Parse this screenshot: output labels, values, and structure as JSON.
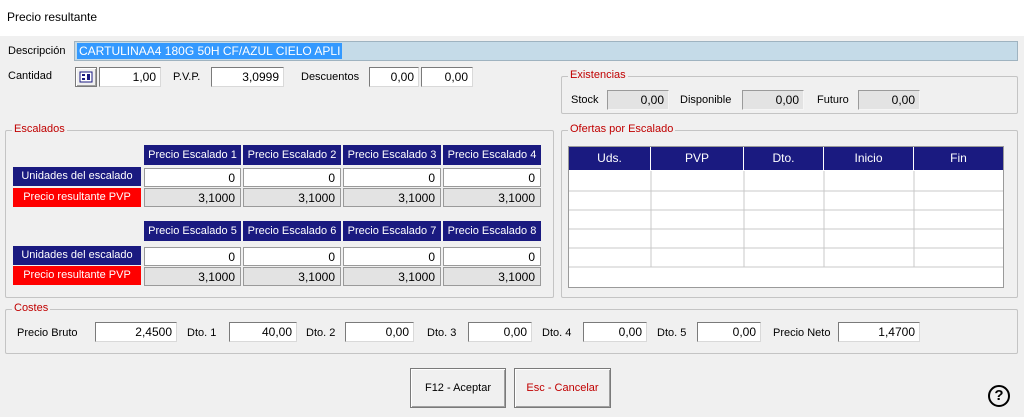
{
  "window": {
    "title": "Precio resultante"
  },
  "header": {
    "descripcion_label": "Descripción",
    "descripcion_value": "CARTULINAA4 180G 50H CF/AZUL CIELO APLI",
    "cantidad_label": "Cantidad",
    "cantidad_value": "1,00",
    "pvp_label": "P.V.P.",
    "pvp_value": "3,0999",
    "descuentos_label": "Descuentos",
    "descuento1_value": "0,00",
    "descuento2_value": "0,00"
  },
  "existencias": {
    "legend": "Existencias",
    "stock_label": "Stock",
    "stock_value": "0,00",
    "disponible_label": "Disponible",
    "disponible_value": "0,00",
    "futuro_label": "Futuro",
    "futuro_value": "0,00"
  },
  "escalados": {
    "legend": "Escalados",
    "row_unidades": "Unidades del escalado",
    "row_precio": "Precio resultante PVP",
    "block1": {
      "headers": [
        "Precio Escalado 1",
        "Precio Escalado 2",
        "Precio Escalado 3",
        "Precio Escalado 4"
      ],
      "unidades": [
        "0",
        "0",
        "0",
        "0"
      ],
      "precios": [
        "3,1000",
        "3,1000",
        "3,1000",
        "3,1000"
      ]
    },
    "block2": {
      "headers": [
        "Precio Escalado 5",
        "Precio Escalado 6",
        "Precio Escalado 7",
        "Precio Escalado 8"
      ],
      "unidades": [
        "0",
        "0",
        "0",
        "0"
      ],
      "precios": [
        "3,1000",
        "3,1000",
        "3,1000",
        "3,1000"
      ]
    }
  },
  "ofertas": {
    "legend": "Ofertas por Escalado",
    "columns": [
      "Uds.",
      "PVP",
      "Dto.",
      "Inicio",
      "Fin"
    ]
  },
  "costes": {
    "legend": "Costes",
    "precio_bruto_label": "Precio Bruto",
    "precio_bruto_value": "2,4500",
    "dto1_label": "Dto. 1",
    "dto1_value": "40,00",
    "dto2_label": "Dto. 2",
    "dto2_value": "0,00",
    "dto3_label": "Dto. 3",
    "dto3_value": "0,00",
    "dto4_label": "Dto. 4",
    "dto4_value": "0,00",
    "dto5_label": "Dto. 5",
    "dto5_value": "0,00",
    "precio_neto_label": "Precio Neto",
    "precio_neto_value": "1,4700"
  },
  "buttons": {
    "aceptar": "F12 - Aceptar",
    "cancelar": "Esc - Cancelar",
    "help": "?"
  },
  "colors": {
    "header_bg": "#1a1a80",
    "pvp_row_bg": "#ff0000",
    "legend_text": "#c00000",
    "selection": "#3399ff"
  }
}
